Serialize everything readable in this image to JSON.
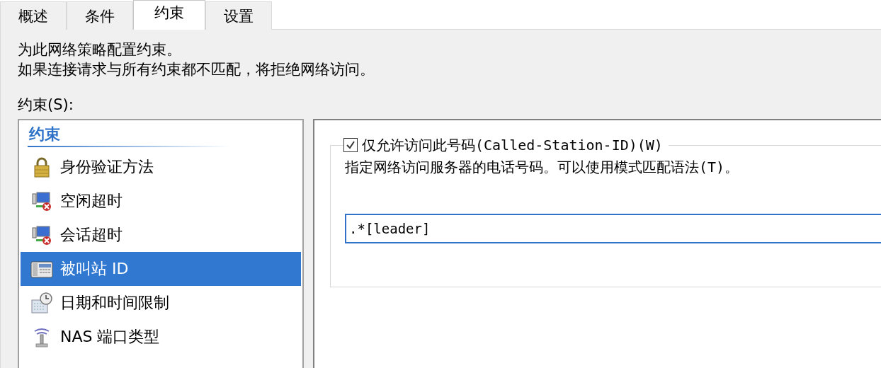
{
  "tabs": [
    {
      "label": "概述",
      "selected": false
    },
    {
      "label": "条件",
      "selected": false
    },
    {
      "label": "约束",
      "selected": true
    },
    {
      "label": "设置",
      "selected": false
    }
  ],
  "intro": [
    "为此网络策略配置约束。",
    "如果连接请求与所有约束都不匹配，将拒绝网络访问。"
  ],
  "constraints_label": "约束(S):",
  "constraints": {
    "heading": "约束",
    "items": [
      {
        "label": "身份验证方法",
        "selected": false
      },
      {
        "label": "空闲超时",
        "selected": false
      },
      {
        "label": "会话超时",
        "selected": false
      },
      {
        "label": "被叫站 ID",
        "selected": true
      },
      {
        "label": "日期和时间限制",
        "selected": false
      },
      {
        "label": "NAS 端口类型",
        "selected": false
      }
    ]
  },
  "detail": {
    "checkbox": {
      "label": "仅允许访问此号码(Called-Station-ID)(W)",
      "checked": true
    },
    "description": "指定网络访问服务器的电话号码。可以使用模式匹配语法(T)。",
    "value": ".*[leader]"
  }
}
